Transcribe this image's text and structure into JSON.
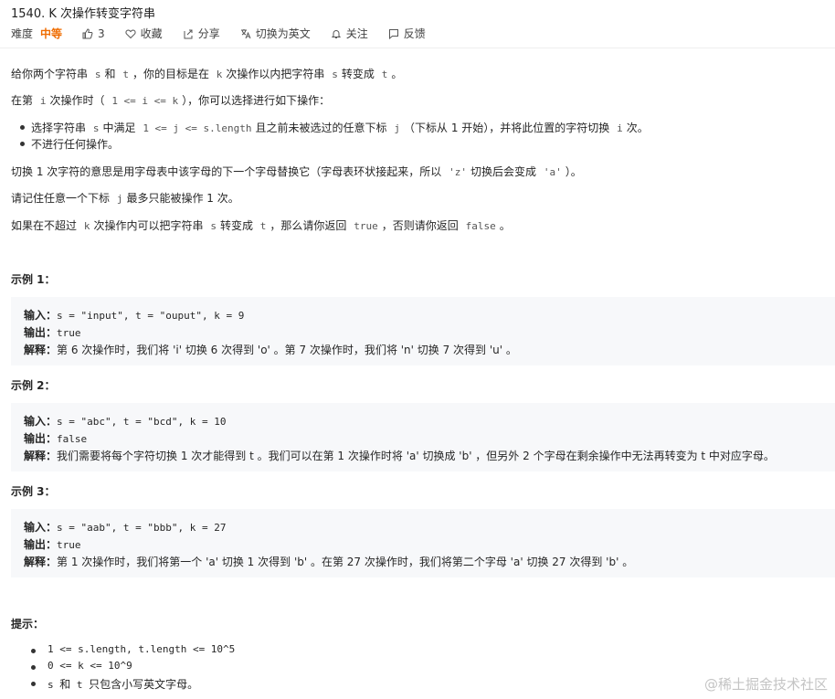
{
  "title": "1540. K 次操作转变字符串",
  "meta": {
    "difficulty_label": "难度",
    "difficulty": "中等",
    "likes": "3",
    "favorite": "收藏",
    "share": "分享",
    "switch_lang": "切换为英文",
    "follow": "关注",
    "feedback": "反馈"
  },
  "desc": {
    "p1": {
      "a": "给你两个字符串",
      "s": "s",
      "and": "和",
      "t": "t",
      "b": "，你的目标是在",
      "k": "k",
      "c": "次操作以内把字符串",
      "s2": "s",
      "d": "转变成",
      "t2": "t",
      "e": "。"
    },
    "p2": {
      "a": "在第",
      "i": "i",
      "b": "次操作时（",
      "cond": "1 <= i <= k",
      "c": "），你可以选择进行如下操作："
    },
    "b1": {
      "a": "选择字符串",
      "s": "s",
      "b": "中满足",
      "cond": "1 <= j <= s.length",
      "c": "且之前未被选过的任意下标",
      "j": "j",
      "d": "（下标从 1 开始），并将此位置的字符切换",
      "i": "i",
      "e": "次。"
    },
    "b2": "不进行任何操作。",
    "p3": {
      "a": "切换 1 次字符的意思是用字母表中该字母的下一个字母替换它（字母表环状接起来，所以",
      "z": "'z'",
      "b": "切换后会变成",
      "a2": "'a'",
      "c": "）。"
    },
    "p4": {
      "a": "请记住任意一个下标",
      "j": "j",
      "b": "最多只能被操作 1 次。"
    },
    "p5": {
      "a": "如果在不超过",
      "k": "k",
      "b": "次操作内可以把字符串",
      "s": "s",
      "c": "转变成",
      "t": "t",
      "d": "，那么请你返回",
      "true": "true",
      "e": "，否则请你返回",
      "false": "false",
      "f": "。"
    }
  },
  "examples": [
    {
      "heading": "示例 1：",
      "input_label": "输入：",
      "input": "s = \"input\", t = \"ouput\", k = 9",
      "output_label": "输出：",
      "output": "true",
      "explain_label": "解释：",
      "explain": "第 6 次操作时，我们将 'i' 切换 6 次得到 'o' 。第 7 次操作时，我们将 'n' 切换 7 次得到 'u' 。"
    },
    {
      "heading": "示例 2：",
      "input_label": "输入：",
      "input": "s = \"abc\", t = \"bcd\", k = 10",
      "output_label": "输出：",
      "output": "false",
      "explain_label": "解释：",
      "explain": "我们需要将每个字符切换 1 次才能得到 t 。我们可以在第 1 次操作时将 'a' 切换成 'b' ，但另外 2 个字母在剩余操作中无法再转变为 t 中对应字母。"
    },
    {
      "heading": "示例 3：",
      "input_label": "输入：",
      "input": "s = \"aab\", t = \"bbb\", k = 27",
      "output_label": "输出：",
      "output": "true",
      "explain_label": "解释：",
      "explain": "第 1 次操作时，我们将第一个 'a' 切换 1 次得到 'b' 。在第 27 次操作时，我们将第二个字母 'a' 切换 27 次得到 'b' 。"
    }
  ],
  "hints": {
    "heading": "提示：",
    "items": [
      "1 <= s.length, t.length <= 10^5",
      "0 <= k <= 10^9"
    ],
    "last": {
      "s": "s",
      "and": "和",
      "t": "t",
      "rest": "只包含小写英文字母。"
    }
  },
  "watermark": "@稀土掘金技术社区"
}
